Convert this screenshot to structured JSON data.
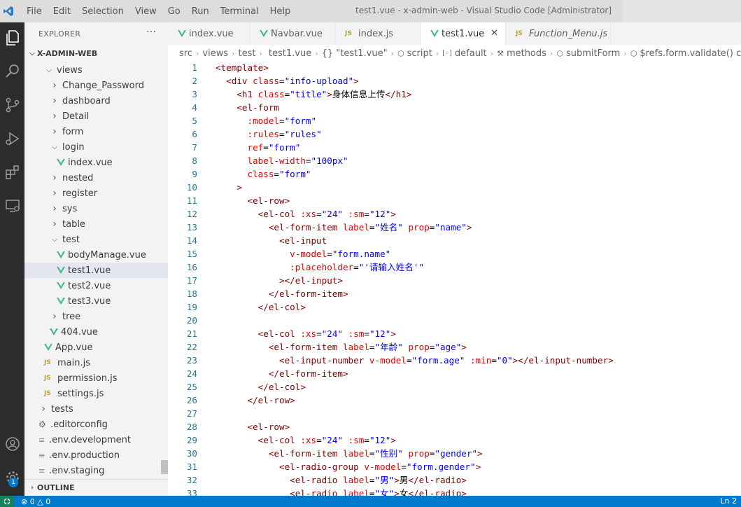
{
  "window": {
    "title": "test1.vue - x-admin-web - Visual Studio Code [Administrator]",
    "menu": [
      "File",
      "Edit",
      "Selection",
      "View",
      "Go",
      "Run",
      "Terminal",
      "Help"
    ]
  },
  "sidebar": {
    "header": "EXPLORER",
    "more": "···",
    "root": "X-ADMIN-WEB",
    "items": [
      {
        "label": "views",
        "kind": "folder-open",
        "depth": 1
      },
      {
        "label": "Change_Password",
        "kind": "folder",
        "depth": 2
      },
      {
        "label": "dashboard",
        "kind": "folder",
        "depth": 2
      },
      {
        "label": "Detail",
        "kind": "folder",
        "depth": 2
      },
      {
        "label": "form",
        "kind": "folder",
        "depth": 2
      },
      {
        "label": "login",
        "kind": "folder-open",
        "depth": 2
      },
      {
        "label": "index.vue",
        "kind": "vue",
        "depth": 3
      },
      {
        "label": "nested",
        "kind": "folder",
        "depth": 2
      },
      {
        "label": "register",
        "kind": "folder",
        "depth": 2
      },
      {
        "label": "sys",
        "kind": "folder",
        "depth": 2
      },
      {
        "label": "table",
        "kind": "folder",
        "depth": 2
      },
      {
        "label": "test",
        "kind": "folder-open",
        "depth": 2
      },
      {
        "label": "bodyManage.vue",
        "kind": "vue",
        "depth": 3
      },
      {
        "label": "test1.vue",
        "kind": "vue",
        "depth": 3,
        "selected": true
      },
      {
        "label": "test2.vue",
        "kind": "vue",
        "depth": 3
      },
      {
        "label": "test3.vue",
        "kind": "vue",
        "depth": 3
      },
      {
        "label": "tree",
        "kind": "folder",
        "depth": 2
      },
      {
        "label": "404.vue",
        "kind": "vue",
        "depth": 2
      },
      {
        "label": "App.vue",
        "kind": "vue",
        "depth": 1
      },
      {
        "label": "main.js",
        "kind": "js",
        "depth": 1
      },
      {
        "label": "permission.js",
        "kind": "js",
        "depth": 1
      },
      {
        "label": "settings.js",
        "kind": "js",
        "depth": 1
      },
      {
        "label": "tests",
        "kind": "folder",
        "depth": 0
      },
      {
        "label": ".editorconfig",
        "kind": "gear",
        "depth": 0
      },
      {
        "label": ".env.development",
        "kind": "lines",
        "depth": 0
      },
      {
        "label": ".env.production",
        "kind": "lines",
        "depth": 0
      },
      {
        "label": ".env.staging",
        "kind": "lines",
        "depth": 0
      }
    ],
    "outline": "OUTLINE"
  },
  "tabs": [
    {
      "label": "index.vue",
      "icon": "vue"
    },
    {
      "label": "Navbar.vue",
      "icon": "vue"
    },
    {
      "label": "index.js",
      "icon": "js"
    },
    {
      "label": "test1.vue",
      "icon": "vue",
      "active": true,
      "close": "✕"
    },
    {
      "label": "Function_Menu.js",
      "icon": "js",
      "italic": true
    }
  ],
  "breadcrumb": [
    "src",
    "views",
    "test",
    "test1.vue",
    "{} \"test1.vue\"",
    "script",
    "default",
    "methods",
    "submitForm",
    "$refs.form.validate() callback"
  ],
  "editor": {
    "lines": [
      [
        [
          "tag",
          "<template>"
        ]
      ],
      [
        [
          "tag",
          "  <div "
        ],
        [
          "attr",
          "class"
        ],
        [
          "text",
          "="
        ],
        [
          "str",
          "\"info-upload\""
        ],
        [
          "tag",
          ">"
        ]
      ],
      [
        [
          "tag",
          "    <h1 "
        ],
        [
          "attr",
          "class"
        ],
        [
          "text",
          "="
        ],
        [
          "str",
          "\"title\""
        ],
        [
          "tag",
          ">"
        ],
        [
          "text",
          "身体信息上传"
        ],
        [
          "tag",
          "</h1>"
        ]
      ],
      [
        [
          "tag",
          "    <el-form"
        ]
      ],
      [
        [
          "attr",
          "      :model"
        ],
        [
          "text",
          "="
        ],
        [
          "str",
          "\"form\""
        ]
      ],
      [
        [
          "attr",
          "      :rules"
        ],
        [
          "text",
          "="
        ],
        [
          "str",
          "\"rules\""
        ]
      ],
      [
        [
          "attr",
          "      ref"
        ],
        [
          "text",
          "="
        ],
        [
          "str",
          "\"form\""
        ]
      ],
      [
        [
          "attr",
          "      label-width"
        ],
        [
          "text",
          "="
        ],
        [
          "str",
          "\"100px\""
        ]
      ],
      [
        [
          "attr",
          "      class"
        ],
        [
          "text",
          "="
        ],
        [
          "str",
          "\"form\""
        ]
      ],
      [
        [
          "tag",
          "    >"
        ]
      ],
      [
        [
          "tag",
          "      <el-row>"
        ]
      ],
      [
        [
          "tag",
          "        <el-col "
        ],
        [
          "attr",
          ":xs"
        ],
        [
          "text",
          "="
        ],
        [
          "str",
          "\"24\""
        ],
        [
          "attr",
          " :sm"
        ],
        [
          "text",
          "="
        ],
        [
          "str",
          "\"12\""
        ],
        [
          "tag",
          ">"
        ]
      ],
      [
        [
          "tag",
          "          <el-form-item "
        ],
        [
          "attr",
          "label"
        ],
        [
          "text",
          "="
        ],
        [
          "str",
          "\"姓名\""
        ],
        [
          "attr",
          " prop"
        ],
        [
          "text",
          "="
        ],
        [
          "str",
          "\"name\""
        ],
        [
          "tag",
          ">"
        ]
      ],
      [
        [
          "tag",
          "            <el-input"
        ]
      ],
      [
        [
          "attr",
          "              v-model"
        ],
        [
          "text",
          "="
        ],
        [
          "str",
          "\"form.name\""
        ]
      ],
      [
        [
          "attr",
          "              :placeholder"
        ],
        [
          "text",
          "="
        ],
        [
          "str",
          "\"'请输入姓名'\""
        ]
      ],
      [
        [
          "tag",
          "            ></el-input>"
        ]
      ],
      [
        [
          "tag",
          "          </el-form-item>"
        ]
      ],
      [
        [
          "tag",
          "        </el-col>"
        ]
      ],
      [
        [
          "text",
          ""
        ]
      ],
      [
        [
          "tag",
          "        <el-col "
        ],
        [
          "attr",
          ":xs"
        ],
        [
          "text",
          "="
        ],
        [
          "str",
          "\"24\""
        ],
        [
          "attr",
          " :sm"
        ],
        [
          "text",
          "="
        ],
        [
          "str",
          "\"12\""
        ],
        [
          "tag",
          ">"
        ]
      ],
      [
        [
          "tag",
          "          <el-form-item "
        ],
        [
          "attr",
          "label"
        ],
        [
          "text",
          "="
        ],
        [
          "str",
          "\"年龄\""
        ],
        [
          "attr",
          " prop"
        ],
        [
          "text",
          "="
        ],
        [
          "str",
          "\"age\""
        ],
        [
          "tag",
          ">"
        ]
      ],
      [
        [
          "tag",
          "            <el-input-number "
        ],
        [
          "attr",
          "v-model"
        ],
        [
          "text",
          "="
        ],
        [
          "str",
          "\"form.age\""
        ],
        [
          "attr",
          " :min"
        ],
        [
          "text",
          "="
        ],
        [
          "str",
          "\"0\""
        ],
        [
          "tag",
          "></el-input-number>"
        ]
      ],
      [
        [
          "tag",
          "          </el-form-item>"
        ]
      ],
      [
        [
          "tag",
          "        </el-col>"
        ]
      ],
      [
        [
          "tag",
          "      </el-row>"
        ]
      ],
      [
        [
          "text",
          ""
        ]
      ],
      [
        [
          "tag",
          "      <el-row>"
        ]
      ],
      [
        [
          "tag",
          "        <el-col "
        ],
        [
          "attr",
          ":xs"
        ],
        [
          "text",
          "="
        ],
        [
          "str",
          "\"24\""
        ],
        [
          "attr",
          " :sm"
        ],
        [
          "text",
          "="
        ],
        [
          "str",
          "\"12\""
        ],
        [
          "tag",
          ">"
        ]
      ],
      [
        [
          "tag",
          "          <el-form-item "
        ],
        [
          "attr",
          "label"
        ],
        [
          "text",
          "="
        ],
        [
          "str",
          "\"性别\""
        ],
        [
          "attr",
          " prop"
        ],
        [
          "text",
          "="
        ],
        [
          "str",
          "\"gender\""
        ],
        [
          "tag",
          ">"
        ]
      ],
      [
        [
          "tag",
          "            <el-radio-group "
        ],
        [
          "attr",
          "v-model"
        ],
        [
          "text",
          "="
        ],
        [
          "str",
          "\"form.gender\""
        ],
        [
          "tag",
          ">"
        ]
      ],
      [
        [
          "tag",
          "              <el-radio "
        ],
        [
          "attr",
          "label"
        ],
        [
          "text",
          "="
        ],
        [
          "str",
          "\"男\""
        ],
        [
          "tag",
          ">"
        ],
        [
          "text",
          "男"
        ],
        [
          "tag",
          "</el-radio>"
        ]
      ],
      [
        [
          "tag",
          "              <el-radio "
        ],
        [
          "attr",
          "label"
        ],
        [
          "text",
          "="
        ],
        [
          "str",
          "\"女\""
        ],
        [
          "tag",
          ">"
        ],
        [
          "text",
          "女"
        ],
        [
          "tag",
          "</el-radio>"
        ]
      ]
    ],
    "line_numbers": [
      "1",
      "2",
      "3",
      "4",
      "5",
      "6",
      "7",
      "8",
      "9",
      "10",
      "11",
      "12",
      "13",
      "14",
      "15",
      "16",
      "17",
      "18",
      "19",
      "20",
      "21",
      "22",
      "23",
      "24",
      "25",
      "26",
      "27",
      "28",
      "29",
      "30",
      "31",
      "32",
      "33"
    ]
  },
  "status": {
    "errors": "0",
    "warnings": "0",
    "position": "Ln 2"
  },
  "colors": {
    "vue": "#41b883",
    "js": "#b8a23c",
    "statusbar": "#007acc",
    "activitybar": "#2c2c2c"
  }
}
